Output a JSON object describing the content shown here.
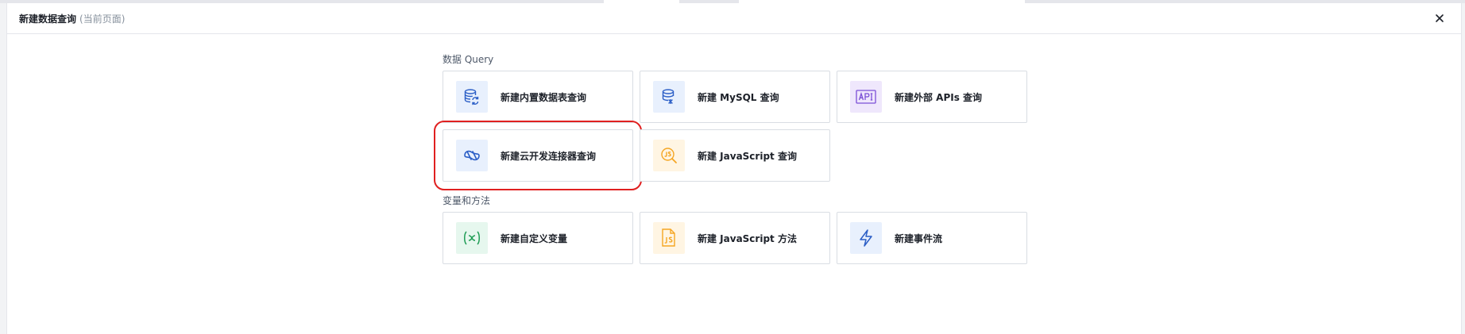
{
  "dialog": {
    "title": "新建数据查询",
    "subtitle": "(当前页面)"
  },
  "sections": [
    {
      "title": "数据 Query",
      "items": [
        {
          "label": "新建内置数据表查询",
          "icon": "database-sync-icon",
          "color": "#2b5ec6",
          "bg": "#e8f0fd"
        },
        {
          "label": "新建 MySQL 查询",
          "icon": "database-cloud-icon",
          "color": "#2b5ec6",
          "bg": "#e8f0fd"
        },
        {
          "label": "新建外部 APIs 查询",
          "icon": "api-icon",
          "color": "#7b4fd6",
          "bg": "#efe7fc"
        },
        {
          "label": "新建云开发连接器查询",
          "icon": "connector-icon",
          "color": "#2b5ec6",
          "bg": "#e8f0fd"
        },
        {
          "label": "新建 JavaScript 查询",
          "icon": "js-search-icon",
          "color": "#f5a623",
          "bg": "#fff5e3"
        }
      ]
    },
    {
      "title": "变量和方法",
      "items": [
        {
          "label": "新建自定义变量",
          "icon": "variable-x-icon",
          "color": "#1f9d55",
          "bg": "#e6f7ee"
        },
        {
          "label": "新建 JavaScript 方法",
          "icon": "js-file-icon",
          "color": "#f5a623",
          "bg": "#fff5e3"
        },
        {
          "label": "新建事件流",
          "icon": "lightning-icon",
          "color": "#2b5ec6",
          "bg": "#e8f0fd"
        }
      ]
    }
  ],
  "highlight": {
    "section": 0,
    "item": 3,
    "color": "#e02020"
  }
}
